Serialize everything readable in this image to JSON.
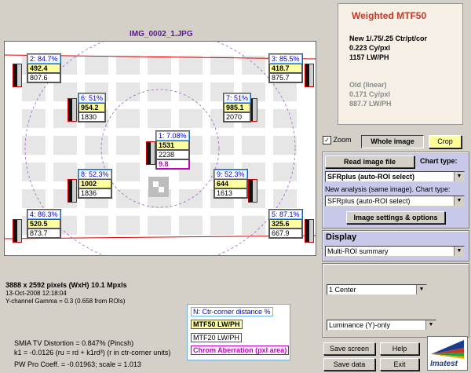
{
  "image_title": "IMG_0002_1.JPG",
  "weighted": {
    "title": "Weighted MTF50",
    "new_label": "New 1/.75/.25 Ctr/pt/cor",
    "new_cy": "0.223 Cy/pxl",
    "new_lw": "1157 LW/PH",
    "old_label": "Old (linear)",
    "old_cy": "0.171 Cy/pxl",
    "old_lw": "887.7 LW/PH"
  },
  "rois": [
    {
      "label": "2: 84.7%",
      "v1": "492.4",
      "v2": "807.6"
    },
    {
      "label": "3: 85.5%",
      "v1": "418.7",
      "v2": "875.7"
    },
    {
      "label": "6: 51%",
      "v1": "954.2",
      "v2": "1830"
    },
    {
      "label": "7: 51%",
      "v1": "985.1",
      "v2": "2070"
    },
    {
      "label": "1: 7.08%",
      "v1": "1531",
      "v2": "2238",
      "ca": "9.8"
    },
    {
      "label": "8: 52.3%",
      "v1": "1002",
      "v2": "1836"
    },
    {
      "label": "9: 52.3%",
      "v1": "644",
      "v2": "1613"
    },
    {
      "label": "4: 86.3%",
      "v1": "520.5",
      "v2": "873.7"
    },
    {
      "label": "5: 87.1%",
      "v1": "325.6",
      "v2": "667.9"
    }
  ],
  "controls": {
    "zoom_label": "Zoom",
    "zoom_checked": "✓",
    "whole_image": "Whole image",
    "crop": "Crop",
    "read_image": "Read image file",
    "chart_type_label": "Chart type:",
    "chart_type_value": "SFRplus (auto-ROI select)",
    "new_analysis_label": "New analysis (same image). Chart type:",
    "new_analysis_value": "SFRplus (auto-ROI select)",
    "image_settings": "Image settings & options",
    "display_title": "Display",
    "display_value": "Multi-ROI summary",
    "region_value": "1  Center",
    "channel_value": "Luminance (Y)-only",
    "save_screen": "Save screen",
    "help": "Help",
    "save_data": "Save data",
    "exit": "Exit",
    "logo_text": "Imatest"
  },
  "info": {
    "size": "3888 x 2592 pixels (WxH)   10.1 Mpxls",
    "date": "13-Oct-2008 12:18:04",
    "channel": "Y-channel    Gamma = 0.3  (0.658 from ROIs)",
    "distortion": "SMIA TV Distortion = 0.847%  (Pincsh)",
    "k1": "k1 = -0.0126  (ru = rd + k1rd³)  (r in ctr-corner units)",
    "pw": "PW Pro Coeff. = -0.01963;  scale = 1.013"
  },
  "legend": {
    "line1": "N:  Ctr-corner distance %",
    "line2": "MTF50  LW/PH",
    "line3": "MTF20  LW/PH",
    "line4": "Chrom Aberration (pxl area)"
  }
}
